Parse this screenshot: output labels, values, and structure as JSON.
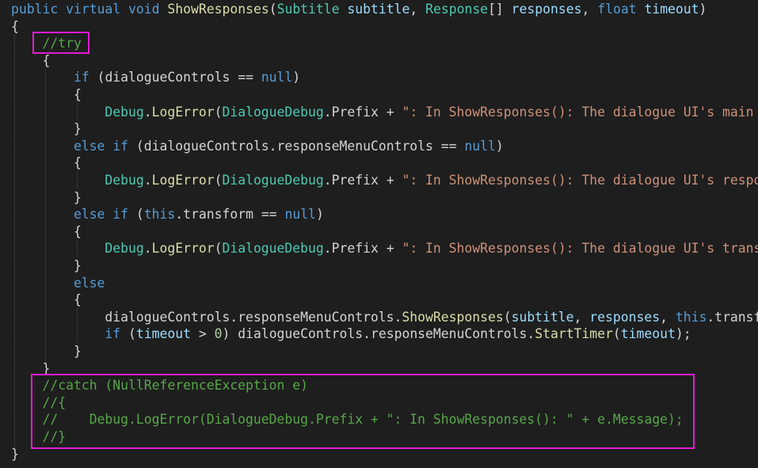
{
  "colors": {
    "background": "#1e1e1e",
    "keyword": "#569cd6",
    "type": "#4ec9b0",
    "parameter": "#9cdcfe",
    "method": "#dcdcaa",
    "string": "#ce9178",
    "number": "#b5cea8",
    "comment": "#57a64a",
    "plain": "#d4d4d4",
    "highlight_box": "#e41ad3"
  },
  "code": {
    "lines": [
      [
        [
          "kw",
          "public"
        ],
        [
          "pl",
          " "
        ],
        [
          "kw",
          "virtual"
        ],
        [
          "pl",
          " "
        ],
        [
          "kw",
          "void"
        ],
        [
          "pl",
          " "
        ],
        [
          "fn",
          "ShowResponses"
        ],
        [
          "pl",
          "("
        ],
        [
          "ty",
          "Subtitle"
        ],
        [
          "pl",
          " "
        ],
        [
          "pa",
          "subtitle"
        ],
        [
          "pl",
          ", "
        ],
        [
          "ty",
          "Response"
        ],
        [
          "pl",
          "[] "
        ],
        [
          "pa",
          "responses"
        ],
        [
          "pl",
          ", "
        ],
        [
          "kw",
          "float"
        ],
        [
          "pl",
          " "
        ],
        [
          "pa",
          "timeout"
        ],
        [
          "pl",
          ")"
        ]
      ],
      [
        [
          "pl",
          "{"
        ]
      ],
      [
        [
          "pl",
          "    "
        ],
        [
          "cm",
          "//try"
        ]
      ],
      [
        [
          "pl",
          "    {"
        ]
      ],
      [
        [
          "pl",
          "        "
        ],
        [
          "kw",
          "if"
        ],
        [
          "pl",
          " (dialogueControls == "
        ],
        [
          "kw",
          "null"
        ],
        [
          "pl",
          ")"
        ]
      ],
      [
        [
          "pl",
          "        {"
        ]
      ],
      [
        [
          "pl",
          "            "
        ],
        [
          "ty",
          "Debug"
        ],
        [
          "pl",
          "."
        ],
        [
          "fn",
          "LogError"
        ],
        [
          "pl",
          "("
        ],
        [
          "ty",
          "DialogueDebug"
        ],
        [
          "pl",
          ".Prefix + "
        ],
        [
          "st",
          "\": In ShowResponses(): The dialogue UI's main"
        ]
      ],
      [
        [
          "pl",
          "        }"
        ]
      ],
      [
        [
          "pl",
          "        "
        ],
        [
          "kw",
          "else"
        ],
        [
          "pl",
          " "
        ],
        [
          "kw",
          "if"
        ],
        [
          "pl",
          " (dialogueControls.responseMenuControls == "
        ],
        [
          "kw",
          "null"
        ],
        [
          "pl",
          ")"
        ]
      ],
      [
        [
          "pl",
          "        {"
        ]
      ],
      [
        [
          "pl",
          "            "
        ],
        [
          "ty",
          "Debug"
        ],
        [
          "pl",
          "."
        ],
        [
          "fn",
          "LogError"
        ],
        [
          "pl",
          "("
        ],
        [
          "ty",
          "DialogueDebug"
        ],
        [
          "pl",
          ".Prefix + "
        ],
        [
          "st",
          "\": In ShowResponses(): The dialogue UI's respo"
        ]
      ],
      [
        [
          "pl",
          "        }"
        ]
      ],
      [
        [
          "pl",
          "        "
        ],
        [
          "kw",
          "else"
        ],
        [
          "pl",
          " "
        ],
        [
          "kw",
          "if"
        ],
        [
          "pl",
          " ("
        ],
        [
          "kw",
          "this"
        ],
        [
          "pl",
          ".transform == "
        ],
        [
          "kw",
          "null"
        ],
        [
          "pl",
          ")"
        ]
      ],
      [
        [
          "pl",
          "        {"
        ]
      ],
      [
        [
          "pl",
          "            "
        ],
        [
          "ty",
          "Debug"
        ],
        [
          "pl",
          "."
        ],
        [
          "fn",
          "LogError"
        ],
        [
          "pl",
          "("
        ],
        [
          "ty",
          "DialogueDebug"
        ],
        [
          "pl",
          ".Prefix + "
        ],
        [
          "st",
          "\": In ShowResponses(): The dialogue UI's trans"
        ]
      ],
      [
        [
          "pl",
          "        }"
        ]
      ],
      [
        [
          "pl",
          "        "
        ],
        [
          "kw",
          "else"
        ]
      ],
      [
        [
          "pl",
          "        {"
        ]
      ],
      [
        [
          "pl",
          "            dialogueControls.responseMenuControls."
        ],
        [
          "fn",
          "ShowResponses"
        ],
        [
          "pl",
          "("
        ],
        [
          "pa",
          "subtitle"
        ],
        [
          "pl",
          ", "
        ],
        [
          "pa",
          "responses"
        ],
        [
          "pl",
          ", "
        ],
        [
          "kw",
          "this"
        ],
        [
          "pl",
          ".transf"
        ]
      ],
      [
        [
          "pl",
          "            "
        ],
        [
          "kw",
          "if"
        ],
        [
          "pl",
          " ("
        ],
        [
          "pa",
          "timeout"
        ],
        [
          "pl",
          " > "
        ],
        [
          "nu",
          "0"
        ],
        [
          "pl",
          ") dialogueControls.responseMenuControls."
        ],
        [
          "fn",
          "StartTimer"
        ],
        [
          "pl",
          "("
        ],
        [
          "pa",
          "timeout"
        ],
        [
          "pl",
          ");"
        ]
      ],
      [
        [
          "pl",
          "        }"
        ]
      ],
      [
        [
          "pl",
          "    }"
        ]
      ],
      [
        [
          "pl",
          "    "
        ],
        [
          "cm",
          "//catch (NullReferenceException e)"
        ]
      ],
      [
        [
          "pl",
          "    "
        ],
        [
          "cm",
          "//{"
        ]
      ],
      [
        [
          "pl",
          "    "
        ],
        [
          "cm",
          "//    Debug.LogError(DialogueDebug.Prefix + \": In ShowResponses(): \" + e.Message);"
        ]
      ],
      [
        [
          "pl",
          "    "
        ],
        [
          "cm",
          "//}"
        ]
      ],
      [
        [
          "pl",
          "}"
        ]
      ]
    ]
  }
}
